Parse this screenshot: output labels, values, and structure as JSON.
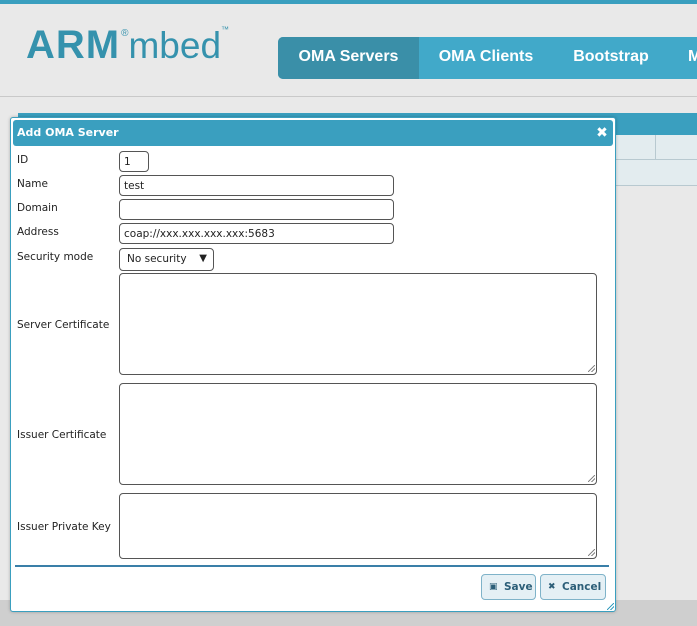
{
  "logo": {
    "brand": "ARM",
    "registered": "®",
    "product": "mbed",
    "trademark": "™"
  },
  "nav": {
    "items": [
      {
        "label": "OMA Servers",
        "active": true
      },
      {
        "label": "OMA Clients",
        "active": false
      },
      {
        "label": "Bootstrap",
        "active": false
      },
      {
        "label": "M",
        "active": false
      }
    ]
  },
  "dialog": {
    "title": "Add OMA Server",
    "close_icon": "close-icon",
    "fields": {
      "id": {
        "label": "ID",
        "value": "1"
      },
      "name": {
        "label": "Name",
        "value": "test"
      },
      "domain": {
        "label": "Domain",
        "value": ""
      },
      "address": {
        "label": "Address",
        "value": "coap://xxx.xxx.xxx.xxx:5683"
      },
      "security_mode": {
        "label": "Security mode",
        "value": "No security"
      },
      "server_certificate": {
        "label": "Server Certificate",
        "value": ""
      },
      "issuer_certificate": {
        "label": "Issuer Certificate",
        "value": ""
      },
      "issuer_private_key": {
        "label": "Issuer Private Key",
        "value": ""
      }
    },
    "buttons": {
      "save": {
        "label": "Save",
        "icon": "save-icon"
      },
      "cancel": {
        "label": "Cancel",
        "icon": "close-icon"
      }
    }
  },
  "colors": {
    "accent": "#3a9fbf",
    "nav_bg": "#41a9c9",
    "nav_active": "#3a8fa8",
    "brand": "#3592ad"
  }
}
